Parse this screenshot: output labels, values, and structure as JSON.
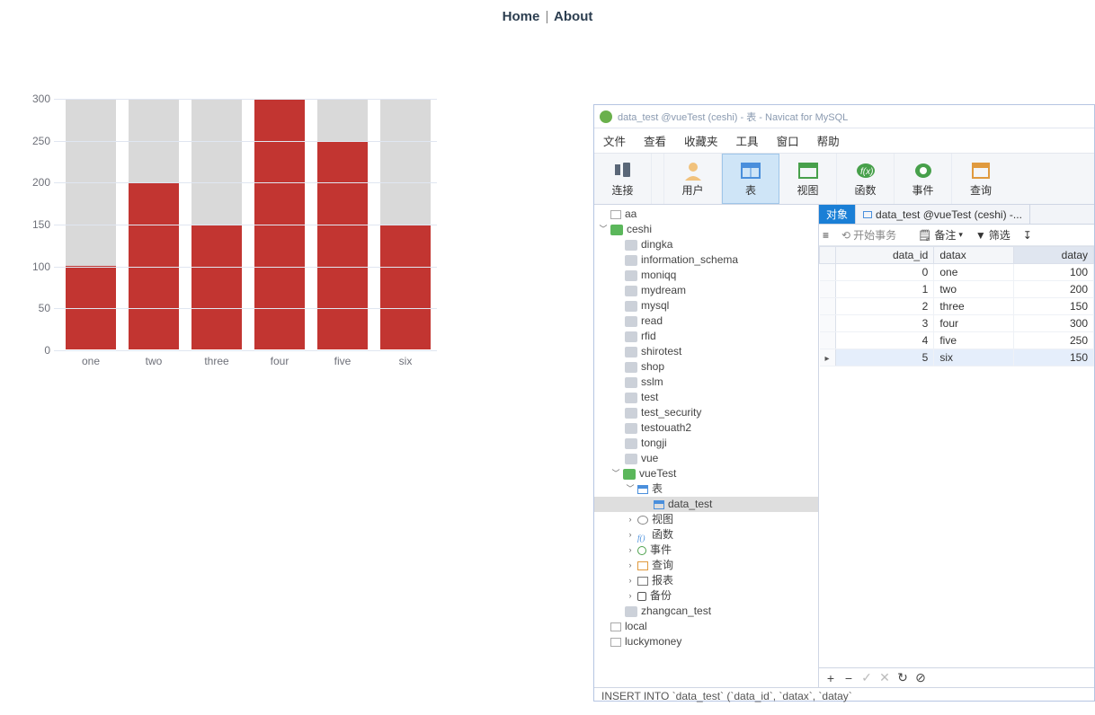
{
  "nav": {
    "home": "Home",
    "sep": "|",
    "about": "About"
  },
  "chart_data": {
    "type": "bar",
    "categories": [
      "one",
      "two",
      "three",
      "four",
      "five",
      "six"
    ],
    "values": [
      100,
      200,
      150,
      300,
      250,
      150
    ],
    "ylim": [
      0,
      300
    ],
    "yticks": [
      0,
      50,
      100,
      150,
      200,
      250,
      300
    ]
  },
  "navicat": {
    "title": "data_test @vueTest (ceshi) - 表 - Navicat for MySQL",
    "menu": [
      "文件",
      "查看",
      "收藏夹",
      "工具",
      "窗口",
      "帮助"
    ],
    "toolbar": {
      "connect": "连接",
      "user": "用户",
      "table": "表",
      "view": "视图",
      "func": "函数",
      "event": "事件",
      "query": "查询"
    },
    "tree": {
      "aa": "aa",
      "ceshi": "ceshi",
      "ceshi_dbs": [
        "dingka",
        "information_schema",
        "moniqq",
        "mydream",
        "mysql",
        "read",
        "rfid",
        "shirotest",
        "shop",
        "sslm",
        "test",
        "test_security",
        "testouath2",
        "tongji",
        "vue"
      ],
      "vueTest": "vueTest",
      "vueTest_tables_label": "表",
      "data_test": "data_test",
      "vueTest_sections": [
        "视图",
        "函数",
        "事件",
        "查询",
        "报表",
        "备份"
      ],
      "zhangcan": "zhangcan_test",
      "local": "local",
      "luckymoney": "luckymoney"
    },
    "tabs": {
      "objects": "对象",
      "dataset": "data_test @vueTest (ceshi) -..."
    },
    "strip": {
      "begin_tx": "开始事务",
      "memo": "备注",
      "filter": "筛选"
    },
    "table": {
      "cols": [
        "data_id",
        "datax",
        "datay"
      ],
      "rows": [
        {
          "data_id": 0,
          "datax": "one",
          "datay": 100
        },
        {
          "data_id": 1,
          "datax": "two",
          "datay": 200
        },
        {
          "data_id": 2,
          "datax": "three",
          "datay": 150
        },
        {
          "data_id": 3,
          "datax": "four",
          "datay": 300
        },
        {
          "data_id": 4,
          "datax": "five",
          "datay": 250
        },
        {
          "data_id": 5,
          "datax": "six",
          "datay": 150
        }
      ],
      "current_row_index": 5
    },
    "status_sql": "INSERT INTO `data_test` (`data_id`, `datax`, `datay`"
  }
}
